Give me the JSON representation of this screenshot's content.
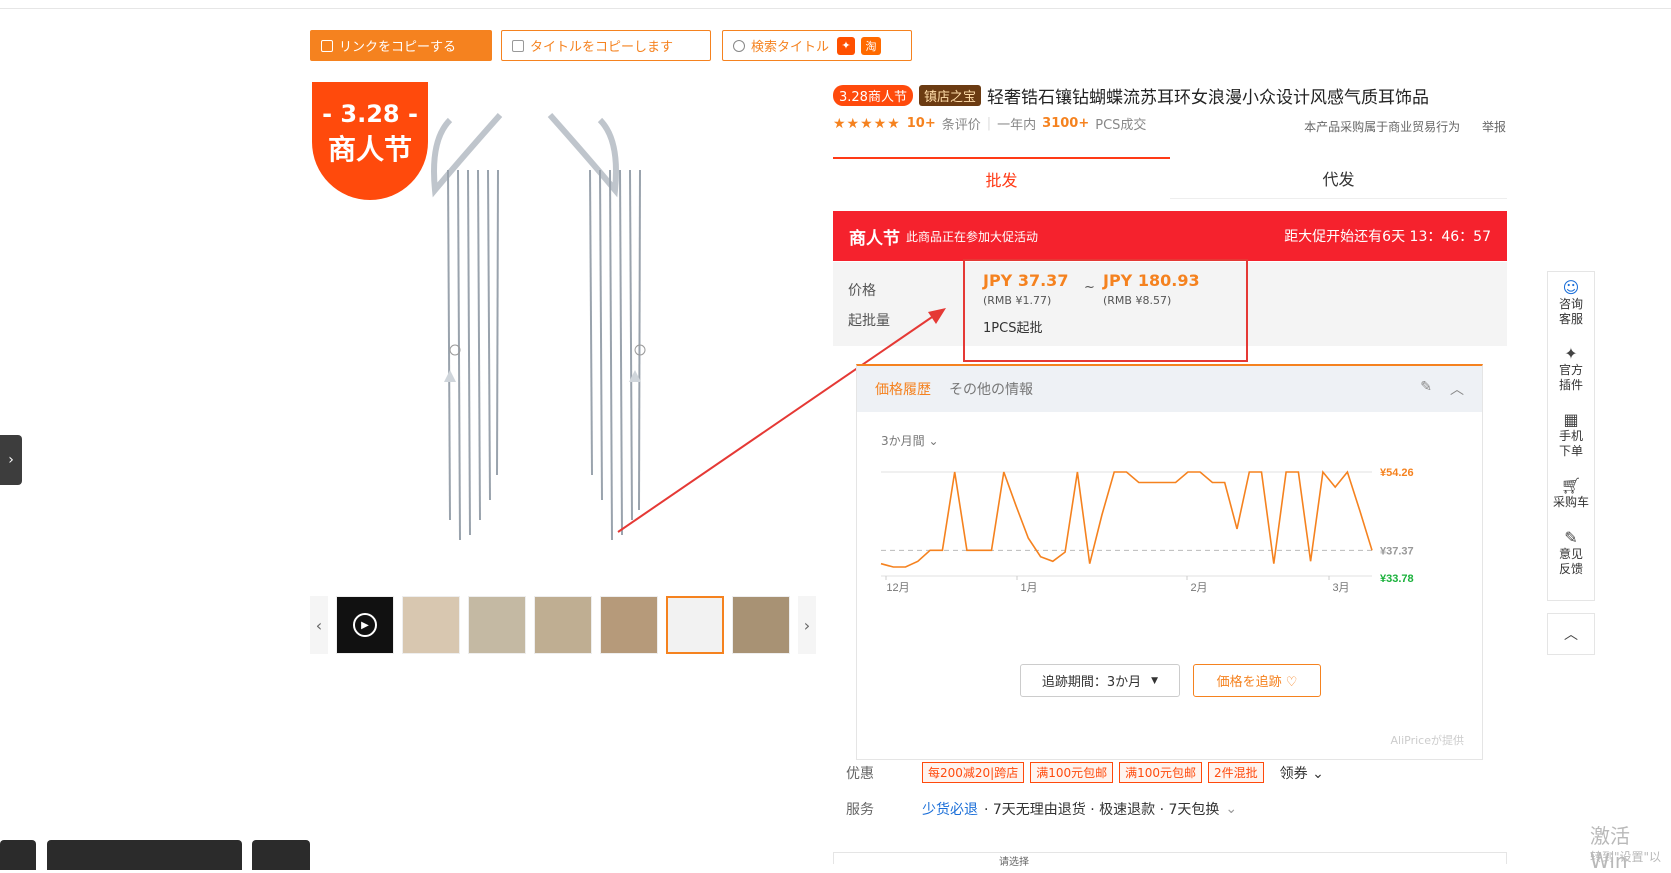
{
  "toolbar": {
    "copy_link": "リンクをコピーする",
    "copy_title": "タイトルをコピーします",
    "search_title": "検索タイトル",
    "taobao_badge": "淘"
  },
  "product": {
    "promo_circle_line1": "- 3.28 -",
    "promo_circle_line2": "商人节",
    "tag_328": "3.28商人节",
    "tag_zhen": "镇店之宝",
    "title": "轻奢锆石镶钻蝴蝶流苏耳环女浪漫小众设计风感气质耳饰品",
    "reviews_count": "10+",
    "reviews_label": "条评价",
    "sep": "|",
    "year_label": "一年内",
    "sold_count": "3100+",
    "sold_label": "PCS成交",
    "business_note": "本产品采购属于商业贸易行为",
    "report": "举报"
  },
  "tabs": {
    "wholesale": "批发",
    "dropship": "代发"
  },
  "promo_bar": {
    "label": "商人节",
    "desc": "此商品正在参加大促活动",
    "countdown": "距大促开始还有6天 13：46：57"
  },
  "price": {
    "price_label": "价格",
    "moq_label": "起批量",
    "low_jpy": "JPY 37.37",
    "low_rmb": "(RMB ¥1.77)",
    "tilde": "~",
    "high_jpy": "JPY 180.93",
    "high_rmb": "(RMB ¥8.57)",
    "moq": "1PCS起批"
  },
  "tracker": {
    "tab_history": "価格履歴",
    "tab_other": "その他の情報",
    "period": "3か月間",
    "track_period": "追跡期間：3か月",
    "track_price": "価格を追跡 ♡",
    "provider": "AliPriceが提供"
  },
  "chart_data": {
    "type": "line",
    "x_ticks": [
      "12月",
      "1月",
      "2月",
      "3月"
    ],
    "y_labels": {
      "max": "¥54.26",
      "current": "¥37.37",
      "min": "¥33.78"
    },
    "values": [
      34.5,
      33.78,
      33.78,
      35,
      37.37,
      37.37,
      54.26,
      37.37,
      37.37,
      37.37,
      54.26,
      47,
      40,
      36,
      35,
      37,
      54.26,
      34.5,
      45,
      54.26,
      54.26,
      52,
      52,
      52,
      52,
      54.26,
      54.26,
      52,
      52,
      42,
      54.26,
      54.26,
      34.5,
      54.26,
      54.26,
      35,
      54.26,
      51,
      54.26,
      46,
      37.37
    ],
    "ylim": [
      33.78,
      54.26
    ],
    "colors": {
      "line": "#f5821f",
      "current": "#bbbbbb",
      "min": "#1ab13b"
    }
  },
  "info": {
    "discount_label": "优惠",
    "coupons": [
      "每200减20|跨店",
      "满100元包邮",
      "满100元包邮",
      "2件混批"
    ],
    "coupon_more": "领券",
    "service_label": "服务",
    "service_link": "少货必退",
    "service_items": "· 7天无理由退货 · 极速退款 · 7天包换"
  },
  "side": {
    "items": [
      "咨询 客服",
      "官方 插件",
      "手机 下单",
      "采购车",
      "意见 反馈"
    ]
  },
  "system": {
    "watermark": "激活 Win",
    "watermark2": "转到\"设置\"以",
    "bottom_card_text": "请选择"
  }
}
